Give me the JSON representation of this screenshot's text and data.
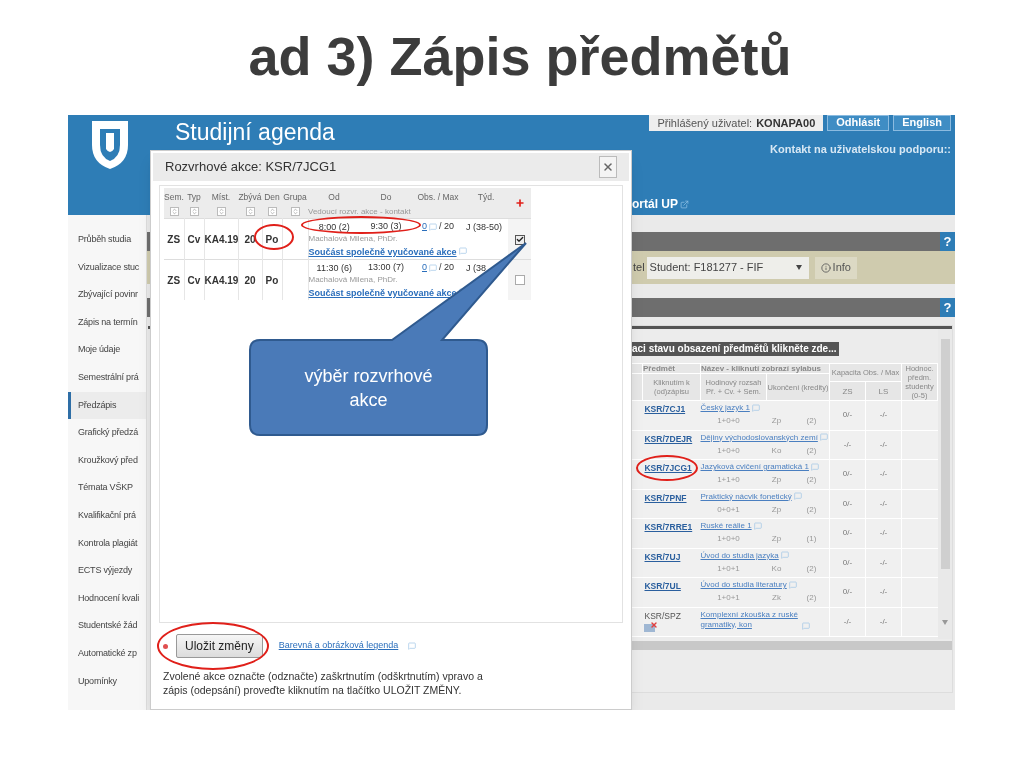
{
  "slide_title": "ad 3) Zápis předmětů",
  "header": {
    "app_title": "Studijní agenda",
    "login_label": "Přihlášený uživatel:",
    "login_user": "KONAPA00",
    "logout_button": "Odhlásit",
    "language_button": "English",
    "support_link": "Kontakt na uživatelskou podporu::",
    "nav_link": "ortál UP"
  },
  "sidebar": {
    "items": [
      {
        "label": "Průběh studia",
        "selected": false
      },
      {
        "label": "Vizualizace stuc",
        "selected": false
      },
      {
        "label": "Zbývající povinr",
        "selected": false
      },
      {
        "label": "Zápis na termín",
        "selected": false
      },
      {
        "label": "Moje údaje",
        "selected": false
      },
      {
        "label": "Semestrální prá",
        "selected": false
      },
      {
        "label": "Předzápis",
        "selected": true
      },
      {
        "label": "Grafický předzá",
        "selected": false
      },
      {
        "label": "Kroužkový před",
        "selected": false
      },
      {
        "label": "Témata VŠKP",
        "selected": false
      },
      {
        "label": "Kvalifikační prá",
        "selected": false
      },
      {
        "label": "Kontrola plagiát",
        "selected": false
      },
      {
        "label": "ECTS výjezdy",
        "selected": false
      },
      {
        "label": "Hodnocení kvali",
        "selected": false
      },
      {
        "label": "Studentské žád",
        "selected": false
      },
      {
        "label": "Automatické zp",
        "selected": false
      },
      {
        "label": "Upomínky",
        "selected": false
      }
    ]
  },
  "help_buttons": [
    "?",
    "?"
  ],
  "filter_bar": {
    "label": "tel",
    "select_value": "Student: F181277 - FIF",
    "info_button": "Info"
  },
  "courses": {
    "banner": "aci stavu obsazení předmětů klikněte zde...",
    "header": {
      "code": "Předmět",
      "name": "Název - kliknutí zobrazí sylabus",
      "code_hint": "Kliknutím k (od)zápisu",
      "hours": "Hodinový rozsah Př. + Cv. + Sem.",
      "completion": "Ukončení (kredity)",
      "capacity": "Kapacita Obs. / Max",
      "zs": "ZS",
      "ls": "LS",
      "rating": "Hodnoc. předm. studenty (0-5)"
    },
    "rows": [
      {
        "kind": "link",
        "code": "KSR/7CJ1",
        "name": "Český jazyk 1",
        "hours": "1+0+0",
        "completion": "Zp",
        "credits": "(2)",
        "zs": "0/-",
        "ls": "-/-",
        "circled": false
      },
      {
        "kind": "link",
        "code": "KSR/7DEJR",
        "name": "Dějiny východoslovanských zemí",
        "hours": "1+0+0",
        "completion": "Ko",
        "credits": "(2)",
        "zs": "-/-",
        "ls": "-/-",
        "circled": false
      },
      {
        "kind": "link",
        "code": "KSR/7JCG1",
        "name": "Jazyková cvičení gramatická 1",
        "hours": "1+1+0",
        "completion": "Zp",
        "credits": "(2)",
        "zs": "0/-",
        "ls": "-/-",
        "circled": true
      },
      {
        "kind": "link",
        "code": "KSR/7PNF",
        "name": "Praktický nácvik fonetický",
        "hours": "0+0+1",
        "completion": "Zp",
        "credits": "(2)",
        "zs": "0/-",
        "ls": "-/-",
        "circled": false
      },
      {
        "kind": "link",
        "code": "KSR/7RRE1",
        "name": "Ruské reálie 1",
        "hours": "1+0+0",
        "completion": "Zp",
        "credits": "(1)",
        "zs": "0/-",
        "ls": "-/-",
        "circled": false
      },
      {
        "kind": "link",
        "code": "KSR/7UJ",
        "name": "Úvod do studia jazyka",
        "hours": "1+0+1",
        "completion": "Ko",
        "credits": "(2)",
        "zs": "0/-",
        "ls": "-/-",
        "circled": false
      },
      {
        "kind": "link",
        "code": "KSR/7UL",
        "name": "Úvod do studia literatury",
        "hours": "1+0+1",
        "completion": "Zk",
        "credits": "(2)",
        "zs": "0/-",
        "ls": "-/-",
        "circled": false
      },
      {
        "kind": "blocked",
        "code": "KSR/SPZ",
        "name": "Komplexní zkouška z ruské gramatiky, kon",
        "zs": "-/-",
        "ls": "-/-",
        "circled": false
      }
    ]
  },
  "dialog": {
    "title": "Rozvrhové akce: KSR/7JCG1",
    "columns": [
      "Sem.",
      "Typ",
      "Míst.",
      "Zbývá",
      "Den",
      "Grupa",
      "Od",
      "Do",
      "Obs. / Max",
      "Týd."
    ],
    "teacher_header": "Vedoucí rozvr. akce - kontakt",
    "rows": [
      {
        "semester": "ZS",
        "type": "Cv",
        "room": "KA4.19",
        "remaining": "20",
        "day": "Po",
        "from": "8:00 (2)",
        "to": "9:30 (3)",
        "occupied": "0",
        "max": "/ 20",
        "weeks": "J (38-50)",
        "teacher": "Machalová Milena, PhDr.",
        "shared_link": "Součást společně vyučované akce",
        "checked": true,
        "day_circled": true,
        "times_circled": true
      },
      {
        "semester": "ZS",
        "type": "Cv",
        "room": "KA4.19",
        "remaining": "20",
        "day": "Po",
        "from": "11:30 (6)",
        "to": "13:00 (7)",
        "occupied": "0",
        "max": "/ 20",
        "weeks": "J (38",
        "teacher": "Machalová Milena, PhDr.",
        "shared_link": "Součást společně vyučované akce",
        "checked": false,
        "day_circled": false,
        "times_circled": false
      }
    ],
    "save_button": "Uložit změny",
    "save_circled": true,
    "legend_link": "Barevná a obrázková legenda",
    "instructions": "Zvolené akce označte (odznačte) zaškrtnutím (odškrtnutím) vpravo a zápis (odepsání) proveďte kliknutím na tlačítko ULOŽIT ZMĚNY."
  },
  "callout": "výběr rozvrhové akce"
}
